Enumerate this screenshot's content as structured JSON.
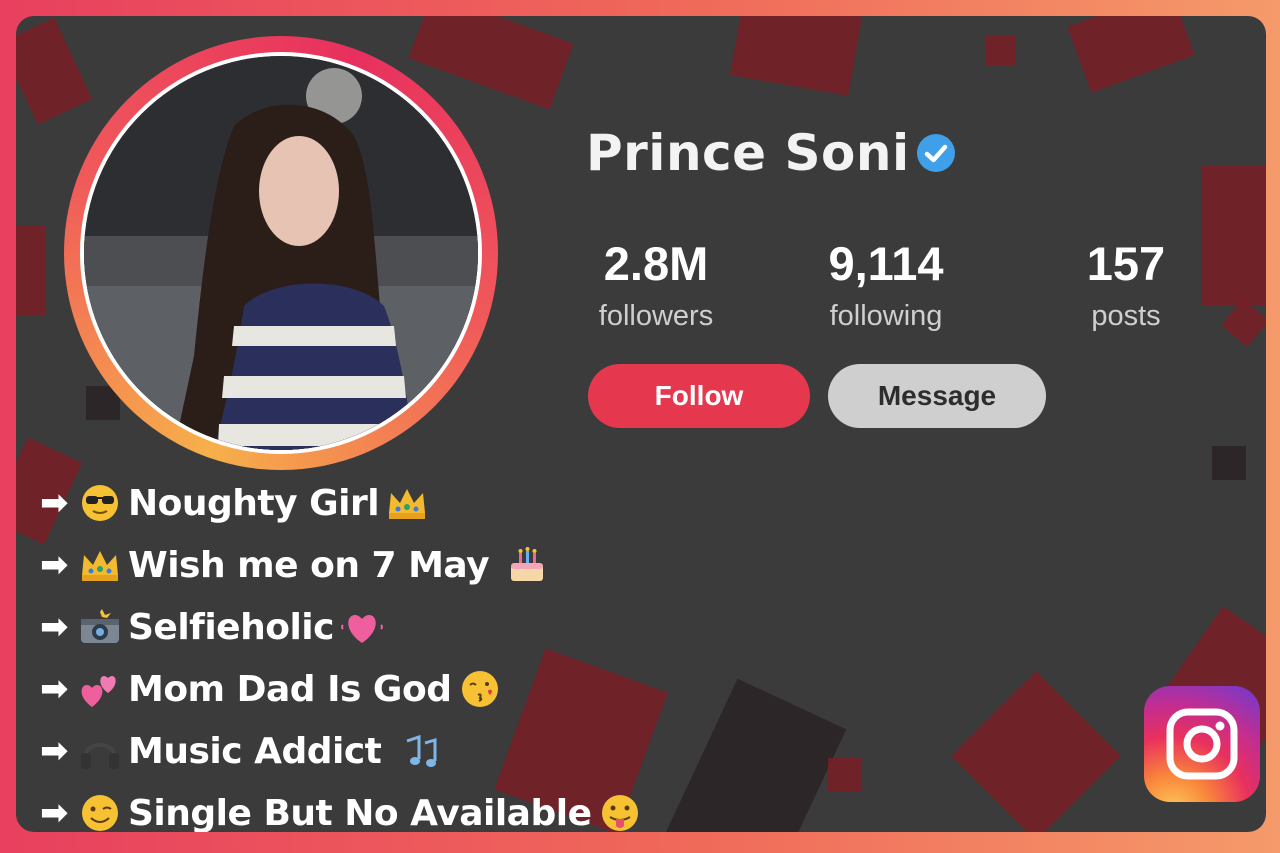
{
  "profile": {
    "name": "Prince Soni",
    "verified": true,
    "stats": [
      {
        "value": "2.8M",
        "label": "followers"
      },
      {
        "value": "9,114",
        "label": "following"
      },
      {
        "value": "157",
        "label": "posts"
      }
    ],
    "follow_label": "Follow",
    "message_label": "Message"
  },
  "bio": [
    {
      "text": "Noughty Girl",
      "lead_icon": "sunglasses-emoji-icon",
      "trail_icon": "crown-emoji-icon"
    },
    {
      "text": "Wish me on 7 May",
      "lead_icon": "crown-emoji-icon",
      "trail_icon": "cake-emoji-icon"
    },
    {
      "text": "Selfieholic",
      "lead_icon": "camera-flash-emoji-icon",
      "trail_icon": "heart-emoji-icon"
    },
    {
      "text": "Mom Dad Is God",
      "lead_icon": "two-hearts-emoji-icon",
      "trail_icon": "kiss-face-emoji-icon"
    },
    {
      "text": "Music Addict",
      "lead_icon": "headphones-emoji-icon",
      "trail_icon": "music-notes-emoji-icon"
    },
    {
      "text": "Single But No Available",
      "lead_icon": "wink-emoji-icon",
      "trail_icon": "tongue-face-emoji-icon"
    }
  ],
  "colors": {
    "follow": "#e5384f",
    "message": "#cfcfcf",
    "background": "#3b3b3c",
    "verified": "#3f9fe8"
  },
  "icons": {
    "instagram": "instagram-logo-icon",
    "verified": "verified-badge-icon"
  }
}
